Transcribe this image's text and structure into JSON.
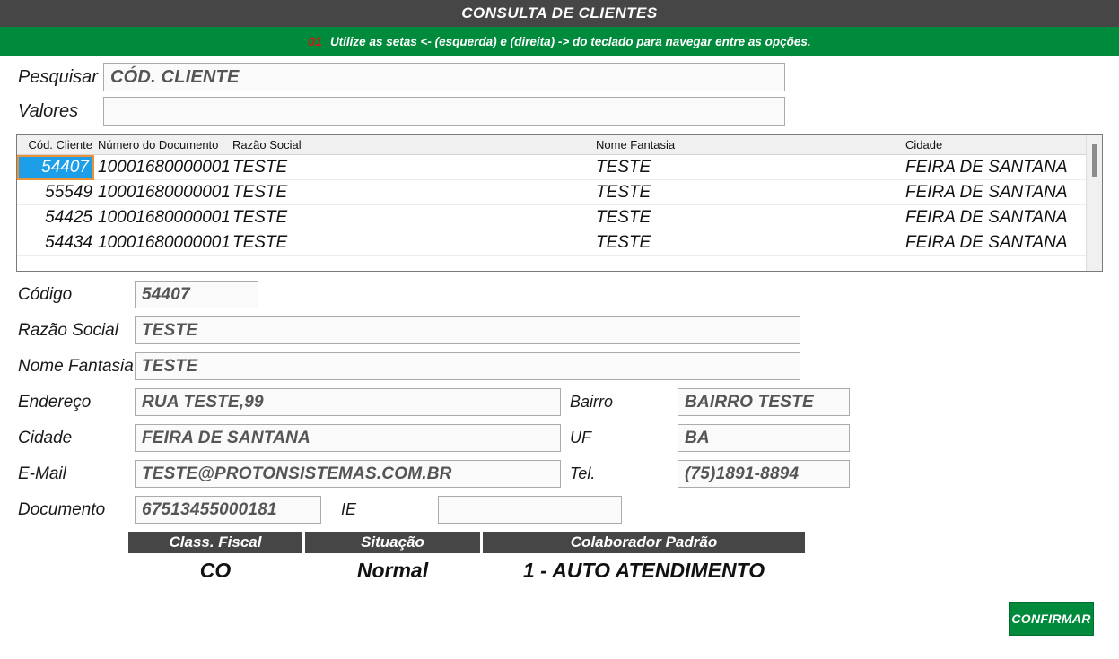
{
  "window": {
    "title": "CONSULTA DE CLIENTES"
  },
  "hint": {
    "number": "01",
    "text": "Utilize as setas <- (esquerda) e (direita) -> do teclado para navegar entre as opções."
  },
  "search": {
    "pesquisar_label": "Pesquisar",
    "pesquisar_value": "CÓD. CLIENTE",
    "valores_label": "Valores",
    "valores_value": "",
    "valores_placeholder": ""
  },
  "grid": {
    "columns": [
      "Cód. Cliente",
      "Número do Documento",
      "Razão Social",
      "Nome Fantasia",
      "Cidade"
    ],
    "rows": [
      {
        "codigo": "54407",
        "documento": "10001680000001",
        "razao_social": "TESTE",
        "nome_fantasia": "TESTE",
        "cidade": "FEIRA DE SANTANA",
        "selected": true
      },
      {
        "codigo": "55549",
        "documento": "10001680000001",
        "razao_social": "TESTE",
        "nome_fantasia": "TESTE",
        "cidade": "FEIRA DE SANTANA",
        "selected": false
      },
      {
        "codigo": "54425",
        "documento": "10001680000001",
        "razao_social": "TESTE",
        "nome_fantasia": "TESTE",
        "cidade": "FEIRA DE SANTANA",
        "selected": false
      },
      {
        "codigo": "54434",
        "documento": "10001680000001",
        "razao_social": "TESTE",
        "nome_fantasia": "TESTE",
        "cidade": "FEIRA DE SANTANA",
        "selected": false
      }
    ]
  },
  "detail": {
    "codigo_label": "Código",
    "codigo_value": "54407",
    "razao_social_label": "Razão Social",
    "razao_social_value": "TESTE",
    "nome_fantasia_label": "Nome Fantasia",
    "nome_fantasia_value": "TESTE",
    "endereco_label": "Endereço",
    "endereco_value": "RUA TESTE,99",
    "bairro_label": "Bairro",
    "bairro_value": "BAIRRO TESTE",
    "cidade_label": "Cidade",
    "cidade_value": "FEIRA DE SANTANA",
    "uf_label": "UF",
    "uf_value": "BA",
    "email_label": "E-Mail",
    "email_value": "TESTE@PROTONSISTEMAS.COM.BR",
    "tel_label": "Tel.",
    "tel_value": "(75)1891-8894",
    "documento_label": "Documento",
    "documento_value": "67513455000181",
    "ie_label": "IE",
    "ie_value": ""
  },
  "info": {
    "headers": [
      "Class. Fiscal",
      "Situação",
      "Colaborador Padrão"
    ],
    "values": [
      "CO",
      "Normal",
      "1 - AUTO ATENDIMENTO"
    ]
  },
  "actions": {
    "confirm_label": "CONFIRMAR"
  },
  "colors": {
    "titlebar": "#464646",
    "accent_green": "#008A3C",
    "hint_number_red": "#E01010",
    "selection_blue": "#1C9FE8",
    "selection_border_orange": "#E8923A"
  }
}
